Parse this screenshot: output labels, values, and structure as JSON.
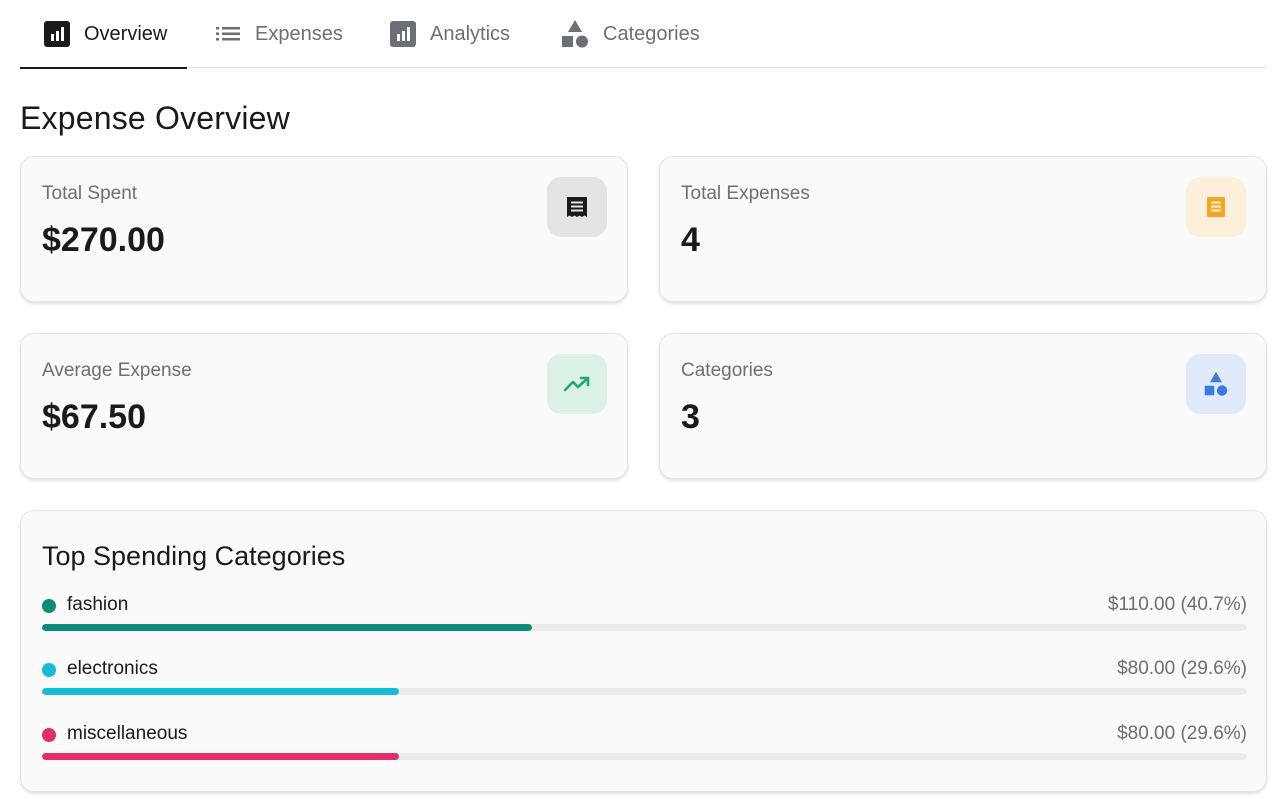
{
  "tabs": [
    {
      "label": "Overview",
      "icon": "bar-chart-icon",
      "active": true
    },
    {
      "label": "Expenses",
      "icon": "list-icon",
      "active": false
    },
    {
      "label": "Analytics",
      "icon": "analytics-icon",
      "active": false
    },
    {
      "label": "Categories",
      "icon": "shapes-icon",
      "active": false
    }
  ],
  "page_title": "Expense Overview",
  "stats": {
    "total_spent": {
      "label": "Total Spent",
      "value": "$270.00",
      "icon": "receipt-icon",
      "color": "#1a1a1a",
      "bg": "#e4e4e4"
    },
    "total_expenses": {
      "label": "Total Expenses",
      "value": "4",
      "icon": "document-icon",
      "color": "#f4a623",
      "bg": "#fdf0da"
    },
    "average_expense": {
      "label": "Average Expense",
      "value": "$67.50",
      "icon": "trending-up-icon",
      "color": "#1fa971",
      "bg": "#ddf2e6"
    },
    "categories": {
      "label": "Categories",
      "value": "3",
      "icon": "shapes-icon",
      "color": "#3b7be0",
      "bg": "#e0eafa"
    }
  },
  "top_categories": {
    "title": "Top Spending Categories",
    "items": [
      {
        "name": "fashion",
        "amount": "$110.00 (40.7%)",
        "percent": 40.7,
        "color": "#0e8c7a"
      },
      {
        "name": "electronics",
        "amount": "$80.00 (29.6%)",
        "percent": 29.6,
        "color": "#16bcd4"
      },
      {
        "name": "miscellaneous",
        "amount": "$80.00 (29.6%)",
        "percent": 29.6,
        "color": "#e02f6b"
      }
    ]
  }
}
